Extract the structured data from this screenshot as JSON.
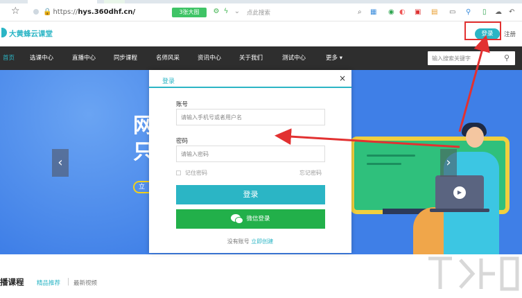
{
  "browser": {
    "url_scheme": "https://",
    "url_host": "hys.360dhf.cn/",
    "big_image_button": "3张大图",
    "search_hint": "点此搜索"
  },
  "site": {
    "logo": "大黄蜂云课堂",
    "login": "登录",
    "register": "注册"
  },
  "nav": {
    "items": [
      {
        "label": "首页",
        "active": true
      },
      {
        "label": "选课中心",
        "active": false
      },
      {
        "label": "直播中心",
        "active": false
      },
      {
        "label": "同步课程",
        "active": false
      },
      {
        "label": "名师风采",
        "active": false
      },
      {
        "label": "资讯中心",
        "active": false
      },
      {
        "label": "关于我们",
        "active": false
      },
      {
        "label": "测试中心",
        "active": false
      },
      {
        "label": "更多 ▾",
        "active": false
      }
    ],
    "search_placeholder": "输入搜索关键字"
  },
  "banner": {
    "char1": "网",
    "char2": "只",
    "pill": "立",
    "prev": "‹",
    "next": "›"
  },
  "modal": {
    "title": "登录",
    "close": "×",
    "account_label": "账号",
    "account_placeholder": "请输入手机号或者用户名",
    "password_label": "密码",
    "password_placeholder": "请输入密码",
    "remember": "记住密码",
    "forgot": "忘记密码",
    "login_button": "登录",
    "wechat_button": "微信登录",
    "no_account": "没有账号",
    "create_now": "立即创建"
  },
  "section": {
    "title": "播课程",
    "tab_recommended": "精品推荐",
    "tab_latest": "最新视频"
  },
  "colors": {
    "accent": "#2bb5c5",
    "wechat": "#22b04a",
    "nav_bg": "#2e2e2e",
    "banner_bg": "#3f7fe7",
    "annotation": "#e23131"
  }
}
